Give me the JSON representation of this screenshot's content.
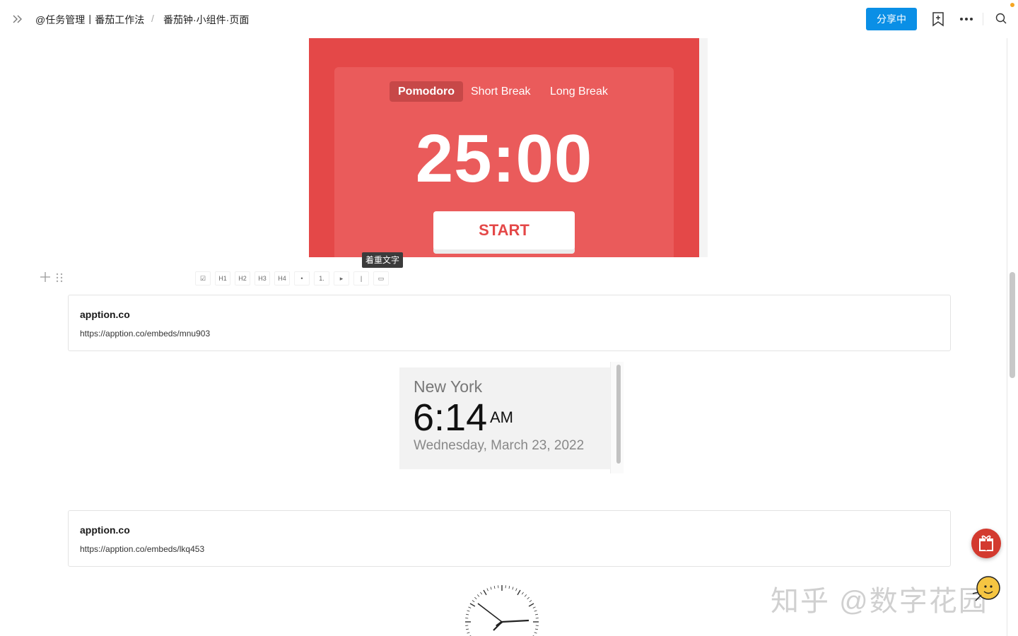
{
  "header": {
    "breadcrumb_1": "@任务管理丨番茄工作法",
    "breadcrumb_sep": "/",
    "breadcrumb_2": "番茄钟·小组件·页面",
    "share_label": "分享中"
  },
  "pomodoro": {
    "tabs": [
      "Pomodoro",
      "Short Break",
      "Long Break"
    ],
    "active_tab": "Pomodoro",
    "time": "25:00",
    "start_label": "START",
    "colors": {
      "background": "#e44848",
      "card": "#ea5b5b"
    }
  },
  "tooltip": "着重文字",
  "toolbar": {
    "buttons": [
      "☑",
      "H1",
      "H2",
      "H3",
      "H4",
      "•",
      "1.",
      "▸",
      "|",
      "▭"
    ]
  },
  "embeds": [
    {
      "title": "apption.co",
      "url": "https://apption.co/embeds/mnu903"
    },
    {
      "title": "apption.co",
      "url": "https://apption.co/embeds/lkq453"
    }
  ],
  "clock": {
    "city": "New York",
    "time": "6:14",
    "ampm": "AM",
    "date": "Wednesday, March 23, 2022"
  },
  "watermark": "知乎 @数字花园",
  "accent_color": "#0a8fe6"
}
